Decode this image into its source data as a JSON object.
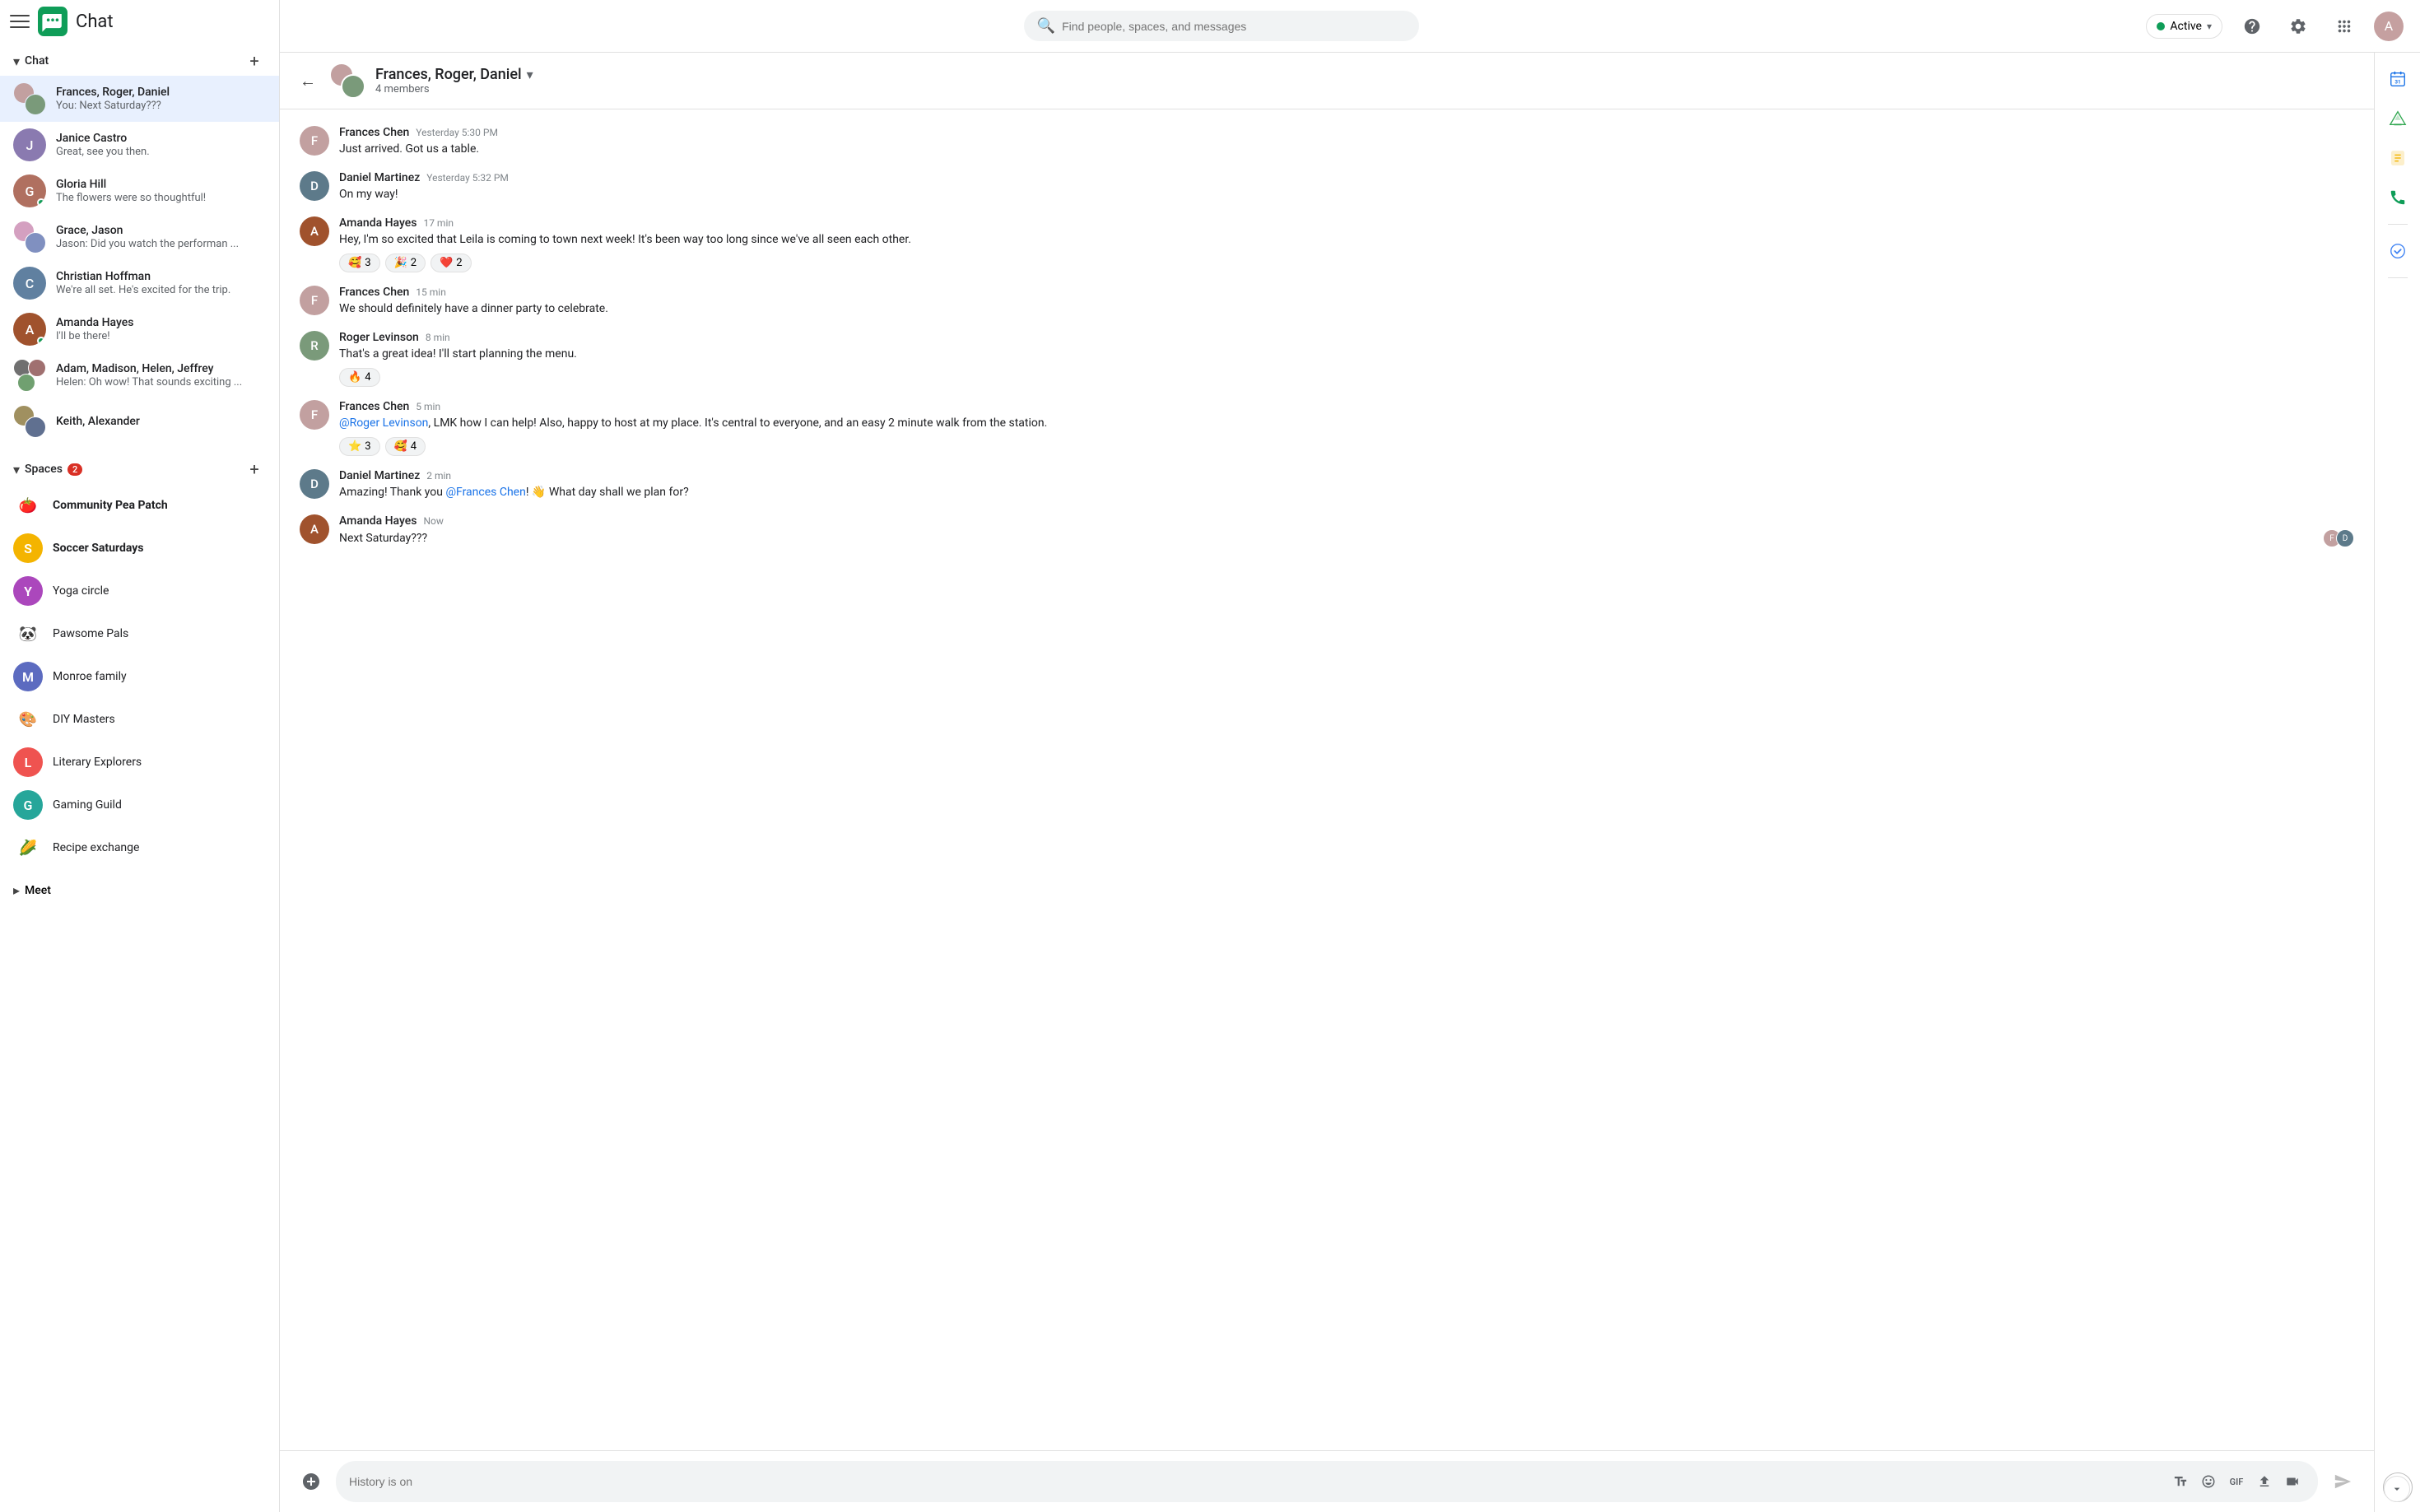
{
  "app": {
    "title": "Chat",
    "search_placeholder": "Find people, spaces, and messages"
  },
  "topbar": {
    "status_label": "Active",
    "status_color": "#0f9d58"
  },
  "chat_section": {
    "label": "Chat",
    "add_label": "+"
  },
  "contacts": [
    {
      "id": "frances-roger-daniel",
      "name": "Frances, Roger, Daniel",
      "preview": "You: Next Saturday???",
      "active": true,
      "group": true
    },
    {
      "id": "janice-castro",
      "name": "Janice Castro",
      "preview": "Great, see you then.",
      "active": false,
      "group": false,
      "online": false
    },
    {
      "id": "gloria-hill",
      "name": "Gloria Hill",
      "preview": "The flowers were so thoughtful!",
      "active": false,
      "group": false,
      "online": true
    },
    {
      "id": "grace-jason",
      "name": "Grace, Jason",
      "preview": "Jason: Did you watch the performan ...",
      "active": false,
      "group": true
    },
    {
      "id": "christian-hoffman",
      "name": "Christian Hoffman",
      "preview": "We're all set.  He's excited for the trip.",
      "active": false,
      "group": false
    },
    {
      "id": "amanda-hayes",
      "name": "Amanda Hayes",
      "preview": "I'll be there!",
      "active": false,
      "online": true,
      "group": false
    },
    {
      "id": "adam-madison-helen-jeffrey",
      "name": "Adam, Madison, Helen, Jeffrey",
      "preview": "Helen: Oh wow! That sounds exciting ...",
      "active": false,
      "group": true
    },
    {
      "id": "keith-alexander",
      "name": "Keith, Alexander",
      "preview": "",
      "active": false,
      "group": true
    }
  ],
  "spaces_section": {
    "label": "Spaces",
    "badge": "2"
  },
  "spaces": [
    {
      "id": "community-pea-patch",
      "name": "Community Pea Patch",
      "icon": "🍅",
      "bold": true
    },
    {
      "id": "soccer-saturdays",
      "name": "Soccer Saturdays",
      "icon": "S",
      "bold": true,
      "icon_bg": "#f4b400"
    },
    {
      "id": "yoga-circle",
      "name": "Yoga circle",
      "icon": "Y",
      "bold": false,
      "icon_bg": "#ab47bc"
    },
    {
      "id": "pawsome-pals",
      "name": "Pawsome Pals",
      "icon": "🐼",
      "bold": false
    },
    {
      "id": "monroe-family",
      "name": "Monroe family",
      "icon": "M",
      "bold": false,
      "icon_bg": "#5c6bc0"
    },
    {
      "id": "diy-masters",
      "name": "DIY Masters",
      "icon": "🎨",
      "bold": false
    },
    {
      "id": "literary-explorers",
      "name": "Literary Explorers",
      "icon": "L",
      "bold": false,
      "icon_bg": "#ef5350"
    },
    {
      "id": "gaming-guild",
      "name": "Gaming Guild",
      "icon": "G",
      "bold": false,
      "icon_bg": "#26a69a"
    },
    {
      "id": "recipe-exchange",
      "name": "Recipe exchange",
      "icon": "🌽",
      "bold": false
    }
  ],
  "meet_section": {
    "label": "Meet"
  },
  "chat_view": {
    "title": "Frances, Roger, Daniel",
    "members": "4 members",
    "messages": [
      {
        "id": "msg1",
        "sender": "Frances Chen",
        "time": "Yesterday 5:30 PM",
        "text": "Just arrived.  Got us a table.",
        "avatar_color": "#c2a0a0",
        "reactions": []
      },
      {
        "id": "msg2",
        "sender": "Daniel Martinez",
        "time": "Yesterday 5:32 PM",
        "text": "On my way!",
        "avatar_color": "#5d7a8a",
        "reactions": []
      },
      {
        "id": "msg3",
        "sender": "Amanda Hayes",
        "time": "17 min",
        "text": "Hey, I'm so excited that Leila is coming to town next week! It's been way too long since we've all seen each other.",
        "avatar_color": "#a0522d",
        "reactions": [
          {
            "emoji": "🥰",
            "count": "3"
          },
          {
            "emoji": "🎉",
            "count": "2"
          },
          {
            "emoji": "❤️",
            "count": "2"
          }
        ]
      },
      {
        "id": "msg4",
        "sender": "Frances Chen",
        "time": "15 min",
        "text": "We should definitely have a dinner party to celebrate.",
        "avatar_color": "#c2a0a0",
        "reactions": []
      },
      {
        "id": "msg5",
        "sender": "Roger Levinson",
        "time": "8 min",
        "text": "That's a great idea! I'll start planning the menu.",
        "avatar_color": "#7a9a7a",
        "reactions": [
          {
            "emoji": "🔥",
            "count": "4"
          }
        ]
      },
      {
        "id": "msg6",
        "sender": "Frances Chen",
        "time": "5 min",
        "text_parts": [
          {
            "type": "mention",
            "text": "@Roger Levinson"
          },
          {
            "type": "normal",
            "text": ", LMK how I can help!  Also, happy to host at my place. It's central to everyone, and an easy 2 minute walk from the station."
          }
        ],
        "avatar_color": "#c2a0a0",
        "reactions": [
          {
            "emoji": "⭐",
            "count": "3"
          },
          {
            "emoji": "🥰",
            "count": "4"
          }
        ]
      },
      {
        "id": "msg7",
        "sender": "Daniel Martinez",
        "time": "2 min",
        "text_parts": [
          {
            "type": "normal",
            "text": "Amazing! Thank you "
          },
          {
            "type": "mention",
            "text": "@Frances Chen"
          },
          {
            "type": "normal",
            "text": "! 👋 What day shall we plan for?"
          }
        ],
        "avatar_color": "#5d7a8a",
        "reactions": []
      },
      {
        "id": "msg8",
        "sender": "Amanda Hayes",
        "time": "Now",
        "text": "Next Saturday???",
        "avatar_color": "#a0522d",
        "reactions": [],
        "show_avatars": true
      }
    ]
  },
  "input": {
    "placeholder": "History is on",
    "history_label": "History is on"
  },
  "right_sidebar": {
    "icons": [
      "calendar",
      "drive",
      "tasks",
      "phone",
      "todo"
    ]
  }
}
